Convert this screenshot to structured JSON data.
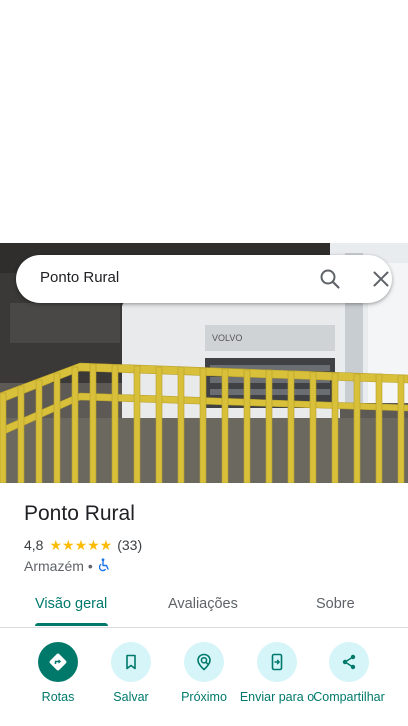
{
  "search": {
    "query": "Ponto Rural"
  },
  "place": {
    "name": "Ponto Rural",
    "rating": "4,8",
    "stars": "★★★★★",
    "review_count": "(33)",
    "category": "Armazém",
    "separator": "•"
  },
  "tabs": [
    {
      "label": "Visão geral",
      "active": true
    },
    {
      "label": "Avaliações",
      "active": false
    },
    {
      "label": "Sobre",
      "active": false
    }
  ],
  "actions": [
    {
      "label": "Rotas",
      "icon": "directions-icon"
    },
    {
      "label": "Salvar",
      "icon": "bookmark-icon"
    },
    {
      "label": "Próximo",
      "icon": "nearby-icon"
    },
    {
      "label": "Enviar para o",
      "icon": "send-to-phone-icon"
    },
    {
      "label": "Compartilhar",
      "icon": "share-icon"
    }
  ],
  "colors": {
    "accent": "#00796b",
    "action_bg": "#d5f5f9",
    "star": "#fbbc04",
    "wheelchair": "#1a73e8"
  }
}
